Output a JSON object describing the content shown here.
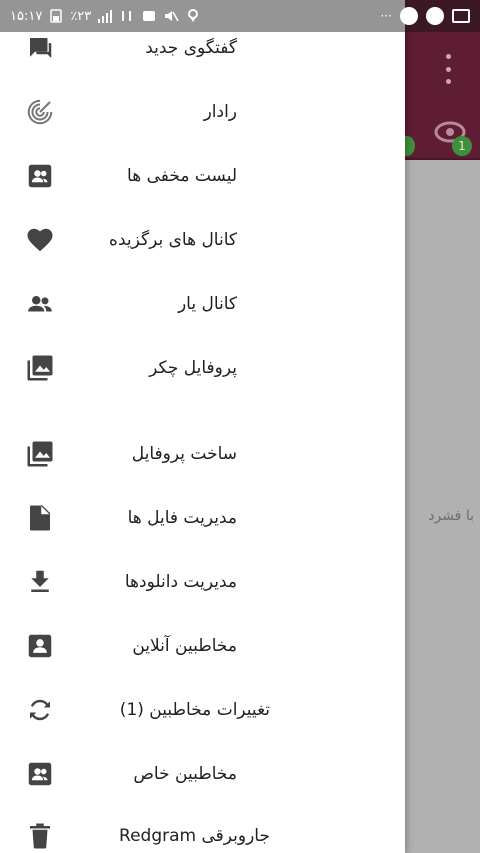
{
  "status_bar": {
    "time": "۱۵:۱۷",
    "battery": "٪۲۳"
  },
  "background": {
    "hint_text": "با فشرد",
    "badge_count": "1"
  },
  "drawer": {
    "items": [
      {
        "label": "گفتگوی جدید",
        "icon": "chat-icon"
      },
      {
        "label": "رادار",
        "icon": "radar-icon"
      },
      {
        "label": "لیست مخفی ها",
        "icon": "contact-box-icon"
      },
      {
        "label": "کانال های برگزیده",
        "icon": "heart-icon"
      },
      {
        "label": "کانال یار",
        "icon": "group-icon"
      },
      {
        "label": "پروفایل چکر",
        "icon": "photo-library-icon"
      },
      {
        "label": "ساخت پروفایل",
        "icon": "photo-library-icon"
      },
      {
        "label": "مدیریت فایل ها",
        "icon": "file-icon"
      },
      {
        "label": "مدیریت دانلودها",
        "icon": "download-icon"
      },
      {
        "label": "مخاطبین آنلاین",
        "icon": "contact-card-icon"
      },
      {
        "label": "تغییرات مخاطبین (1)",
        "icon": "sync-icon"
      },
      {
        "label": "مخاطبین خاص",
        "icon": "contact-box-icon"
      },
      {
        "label": "جاروبرقی Redgram",
        "icon": "trash-icon"
      }
    ]
  },
  "colors": {
    "toolbar": "#5e1d33",
    "icon": "#444444",
    "badge": "#3f8f3c"
  }
}
